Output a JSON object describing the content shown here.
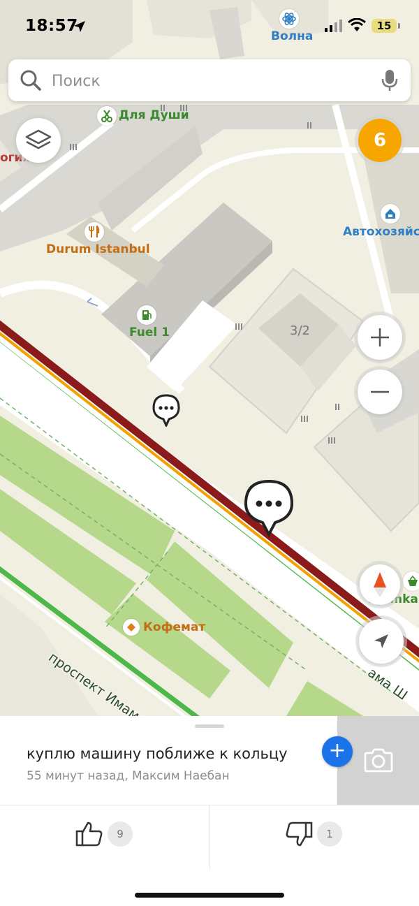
{
  "status_bar": {
    "time": "18:57",
    "battery": "15"
  },
  "search": {
    "placeholder": "Поиск"
  },
  "map": {
    "traffic_level": "6",
    "pois": {
      "volna": "Волна",
      "dlya_dushi": "Для Души",
      "partial_left": "огия",
      "durum": "Durum Istanbul",
      "fuel": "Fuel 1",
      "avtokhoz": "Автохозяйст",
      "djamka": "Djamka",
      "kofemat": "Кофемат"
    },
    "building_number": "3/2",
    "streets": {
      "main": "проспект Имама Ша",
      "main_right": "ама Ш"
    },
    "icons": [
      "layers-icon",
      "plus-icon",
      "minus-icon",
      "compass-icon",
      "locate-arrow-icon",
      "chat-bubble-icon"
    ],
    "colors": {
      "traffic_red": "#8b1a1a",
      "traffic_orange": "#f2a100",
      "traffic_green": "#4cb848",
      "park": "#b6d88a",
      "badge": "#f7a600"
    }
  },
  "post": {
    "text": "куплю машину поближе к кольцу",
    "meta": "55 минут назад, Максим Наебан",
    "likes": "9",
    "dislikes": "1"
  }
}
